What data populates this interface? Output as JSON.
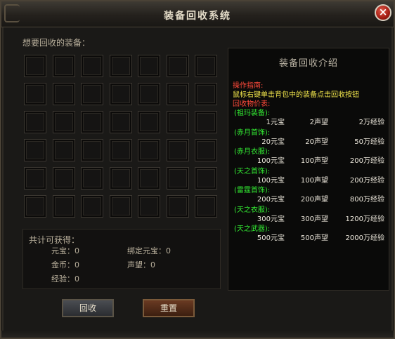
{
  "window": {
    "title": "装备回收系统",
    "close_icon": "×"
  },
  "left": {
    "label": "想要回收的装备：",
    "rows": 6,
    "cols": 7
  },
  "total": {
    "title": "共计可获得：",
    "items": [
      {
        "label": "元宝：",
        "value": "0"
      },
      {
        "label": "绑定元宝：",
        "value": "0"
      },
      {
        "label": "金币：",
        "value": "0"
      },
      {
        "label": "声望：",
        "value": "0"
      },
      {
        "label": "经验：",
        "value": "0"
      }
    ]
  },
  "buttons": {
    "recycle": "回收",
    "reset": "重置"
  },
  "intro": {
    "title": "装备回收介绍",
    "guide_title": "操作指南:",
    "guide_text": "鼠标右键单击背包中的装备点击回收按钮",
    "price_title": "回收物价表:",
    "categories": [
      {
        "name": "(祖玛装备):",
        "yuanbao": "1元宝",
        "shengwang": "2声望",
        "jingyan": "2万经验"
      },
      {
        "name": "(赤月首饰):",
        "yuanbao": "20元宝",
        "shengwang": "20声望",
        "jingyan": "50万经验"
      },
      {
        "name": "(赤月衣服):",
        "yuanbao": "100元宝",
        "shengwang": "100声望",
        "jingyan": "200万经验"
      },
      {
        "name": "(天之首饰):",
        "yuanbao": "100元宝",
        "shengwang": "100声望",
        "jingyan": "200万经验"
      },
      {
        "name": "(雷霆首饰):",
        "yuanbao": "200元宝",
        "shengwang": "200声望",
        "jingyan": "800万经验"
      },
      {
        "name": "(天之衣服):",
        "yuanbao": "300元宝",
        "shengwang": "300声望",
        "jingyan": "1200万经验"
      },
      {
        "name": "(天之武器):",
        "yuanbao": "500元宝",
        "shengwang": "500声望",
        "jingyan": "2000万经验"
      }
    ]
  },
  "colors": {
    "guide": "#ff4a3a",
    "category": "#33ee33",
    "guide_text": "#f2e64c"
  }
}
